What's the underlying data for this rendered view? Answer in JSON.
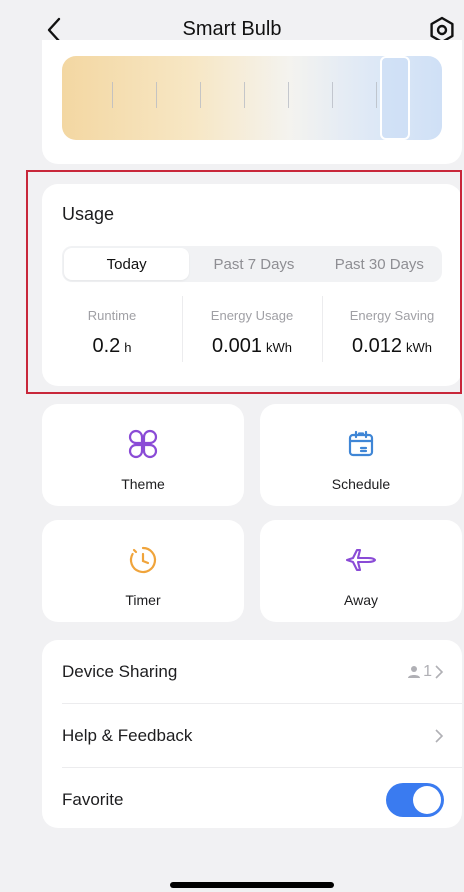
{
  "header": {
    "title": "Smart Bulb",
    "back_icon": "chevron-left-icon",
    "settings_icon": "hex-settings-icon"
  },
  "color_temperature": {
    "level": 0.92
  },
  "usage": {
    "title": "Usage",
    "tabs": [
      {
        "label": "Today",
        "active": true
      },
      {
        "label": "Past 7 Days",
        "active": false
      },
      {
        "label": "Past 30 Days",
        "active": false
      }
    ],
    "stats": [
      {
        "label": "Runtime",
        "value": "0.2",
        "unit": "h"
      },
      {
        "label": "Energy Usage",
        "value": "0.001",
        "unit": "kWh"
      },
      {
        "label": "Energy Saving",
        "value": "0.012",
        "unit": "kWh"
      }
    ]
  },
  "tiles": [
    {
      "label": "Theme",
      "icon": "theme-icon",
      "color": "#8a4bd6"
    },
    {
      "label": "Schedule",
      "icon": "calendar-icon",
      "color": "#3f86d6"
    },
    {
      "label": "Timer",
      "icon": "clock-icon",
      "color": "#f0a43b"
    },
    {
      "label": "Away",
      "icon": "airplane-icon",
      "color": "#8a4bd6"
    }
  ],
  "list": {
    "device_sharing": {
      "label": "Device Sharing",
      "count": "1"
    },
    "help": {
      "label": "Help & Feedback"
    },
    "favorite": {
      "label": "Favorite",
      "on": true
    }
  },
  "colors": {
    "accent": "#3a7bf0",
    "highlight": "#c8273a"
  }
}
